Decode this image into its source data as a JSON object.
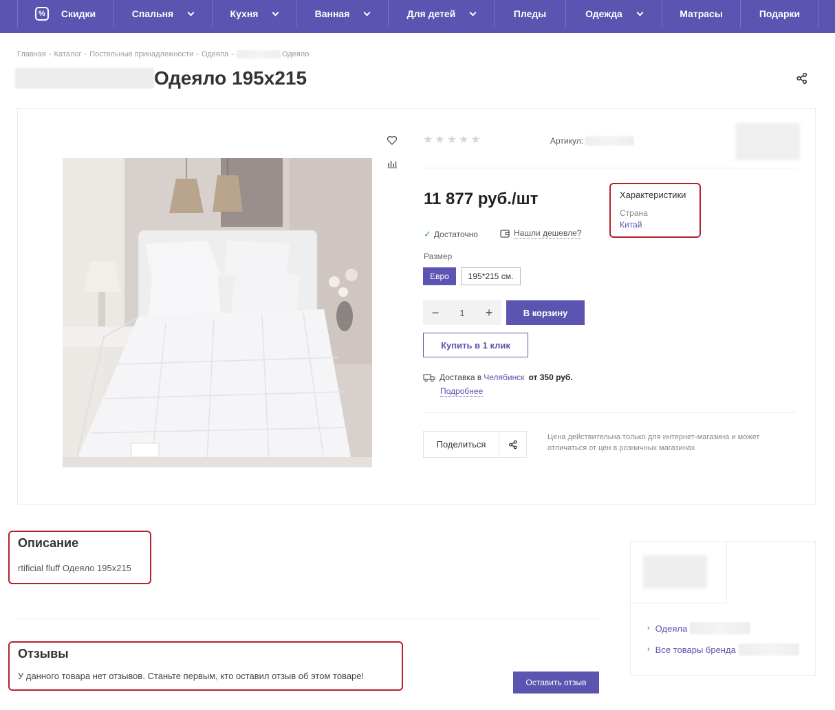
{
  "nav": {
    "items": [
      {
        "label": "Скидки",
        "has_chevron": false,
        "icon": "percent-icon"
      },
      {
        "label": "Спальня",
        "has_chevron": true
      },
      {
        "label": "Кухня",
        "has_chevron": true
      },
      {
        "label": "Ванная",
        "has_chevron": true
      },
      {
        "label": "Для детей",
        "has_chevron": true
      },
      {
        "label": "Пледы",
        "has_chevron": false
      },
      {
        "label": "Одежда",
        "has_chevron": true
      },
      {
        "label": "Матрасы",
        "has_chevron": false
      },
      {
        "label": "Подарки",
        "has_chevron": false
      }
    ],
    "percent_glyph": "%"
  },
  "breadcrumb": {
    "items": [
      "Главная",
      "Каталог",
      "Постельные принадлежности",
      "Одеяла"
    ],
    "current": "Одеяло",
    "separator": "-"
  },
  "product": {
    "title": "Одеяло 195x215",
    "rating_stars": "★★★★★",
    "article_label": "Артикул:",
    "price": "11 877 руб./шт",
    "stock": "Достаточно",
    "cheaper_link": "Нашли дешевле?",
    "size_label": "Размер",
    "sizes": [
      "Евро",
      "195*215 см."
    ],
    "quantity": "1",
    "qty_minus": "−",
    "qty_plus": "+",
    "cart_button": "В корзину",
    "one_click_button": "Купить в 1 клик",
    "delivery_prefix": "Доставка в",
    "delivery_city": "Челябинск",
    "delivery_price": "от 350 руб.",
    "delivery_more": "Подробнее",
    "share_label": "Поделиться",
    "price_note": "Цена действительна только для интернет-магазина и может отличаться от цен в розничных магазинах"
  },
  "characteristics": {
    "title": "Характеристики",
    "key": "Страна",
    "value": "Китай"
  },
  "description": {
    "title": "Описание",
    "text": "rtificial fluff Одеяло 195x215"
  },
  "reviews": {
    "title": "Отзывы",
    "text": "У данного товара нет отзывов. Станьте первым, кто оставил отзыв об этом товаре!",
    "button": "Оставить отзыв"
  },
  "brand_card": {
    "links": [
      "Одеяла",
      "Все товары бренда"
    ]
  },
  "colors": {
    "accent": "#5b54b0",
    "highlight_border": "#b3202c",
    "in_stock": "#3ca44a"
  }
}
